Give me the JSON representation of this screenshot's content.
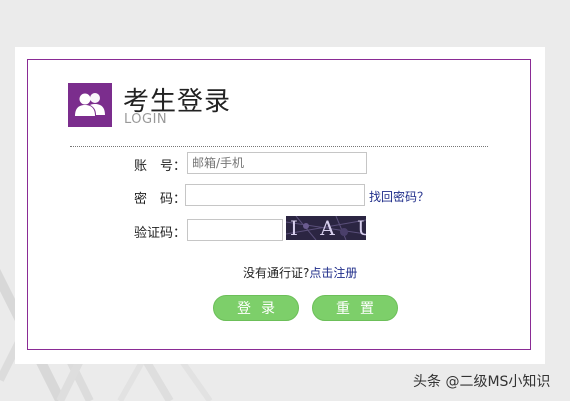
{
  "header": {
    "title": "考生登录",
    "subtitle": "LOGIN",
    "logo_icon": "users-icon"
  },
  "form": {
    "account_label": "账　号：",
    "account_placeholder": "邮箱/手机",
    "password_label": "密　码：",
    "password_value": "",
    "forgot_password_link": "找回密码？",
    "captcha_label": "验证码：",
    "captcha_value": "",
    "captcha_text": "I A U",
    "no_pass_text": "没有通行证?",
    "register_link": "点击注册"
  },
  "buttons": {
    "login_label": "登录",
    "reset_label": "重置"
  },
  "watermark": {
    "text": "头条 @二级MS小知识"
  },
  "colors": {
    "accent": "#7b2d8d",
    "button": "#7dcf6a",
    "link": "#1f2d8a"
  }
}
